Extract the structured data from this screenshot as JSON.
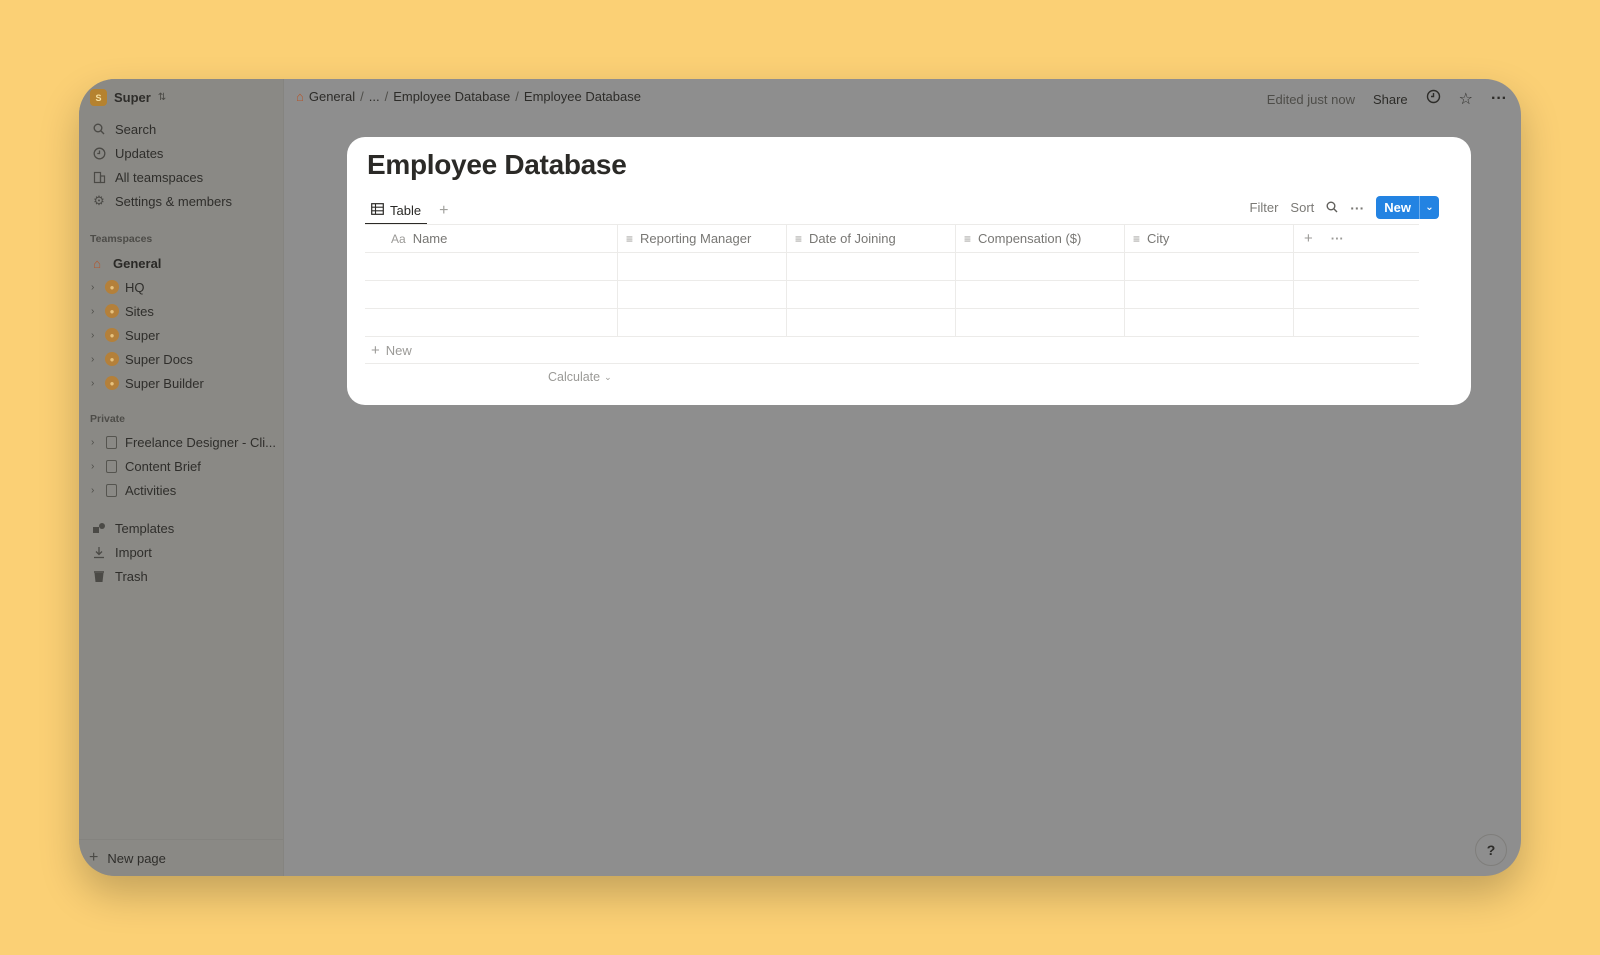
{
  "workspace": {
    "name": "Super",
    "logo": "S",
    "switch_icon": "chevron-updown-icon"
  },
  "sidebar": {
    "top_items": [
      {
        "label": "Search",
        "icon": "search-icon"
      },
      {
        "label": "Updates",
        "icon": "clock-icon"
      },
      {
        "label": "All teamspaces",
        "icon": "building-icon"
      },
      {
        "label": "Settings & members",
        "icon": "gear-icon"
      }
    ],
    "teamspaces_label": "Teamspaces",
    "teamspaces": [
      {
        "label": "General",
        "icon": "home-icon"
      },
      {
        "label": "HQ",
        "icon": "teamspace-icon"
      },
      {
        "label": "Sites",
        "icon": "teamspace-icon"
      },
      {
        "label": "Super",
        "icon": "teamspace-icon"
      },
      {
        "label": "Super Docs",
        "icon": "teamspace-icon"
      },
      {
        "label": "Super Builder",
        "icon": "teamspace-icon"
      }
    ],
    "private_label": "Private",
    "private": [
      {
        "label": "Freelance Designer - Cli...",
        "icon": "page-icon"
      },
      {
        "label": "Content Brief",
        "icon": "page-icon"
      },
      {
        "label": "Activities",
        "icon": "page-icon"
      }
    ],
    "bottom_items": [
      {
        "label": "Templates",
        "icon": "templates-icon"
      },
      {
        "label": "Import",
        "icon": "import-icon"
      },
      {
        "label": "Trash",
        "icon": "trash-icon"
      }
    ],
    "new_page": "New page"
  },
  "breadcrumb": {
    "items": [
      "General",
      "...",
      "Employee Database",
      "Employee Database"
    ],
    "sep": "/"
  },
  "topbar": {
    "edited": "Edited just now",
    "share": "Share"
  },
  "page": {
    "title": "Employee Database",
    "view_tab": "Table",
    "actions": {
      "filter": "Filter",
      "sort": "Sort",
      "new": "New"
    },
    "columns": [
      {
        "label": "Name",
        "icon": "Aa"
      },
      {
        "label": "Reporting Manager",
        "icon": "text-icon"
      },
      {
        "label": "Date of Joining",
        "icon": "text-icon"
      },
      {
        "label": "Compensation ($)",
        "icon": "text-icon"
      },
      {
        "label": "City",
        "icon": "text-icon"
      }
    ],
    "rows": [
      [
        "",
        "",
        "",
        "",
        ""
      ],
      [
        "",
        "",
        "",
        "",
        ""
      ],
      [
        "",
        "",
        "",
        "",
        ""
      ]
    ],
    "new_row": "New",
    "calculate": "Calculate"
  },
  "help": "?",
  "colors": {
    "accent": "#2383e2",
    "background": "#fbd075",
    "overlay": "#8e8e8e"
  }
}
